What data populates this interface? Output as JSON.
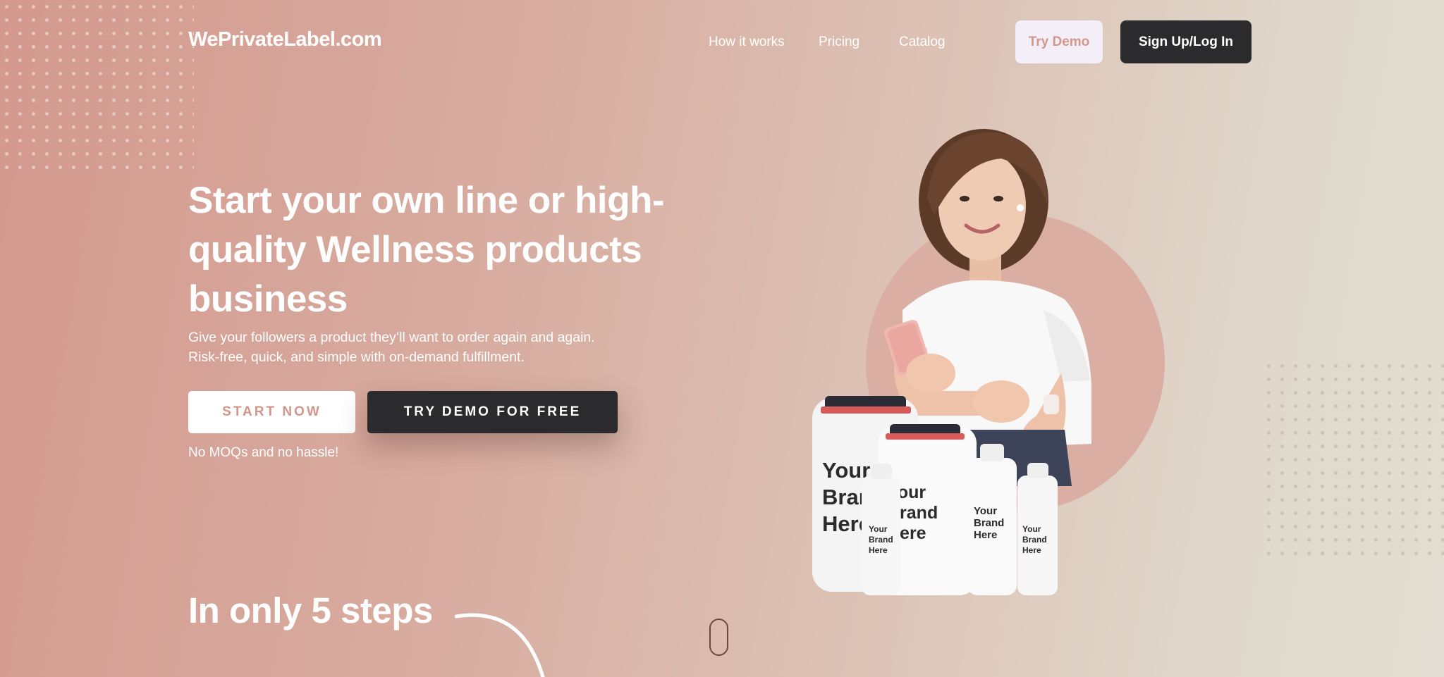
{
  "header": {
    "logo": "WePrivateLabel.com",
    "nav": {
      "how_it_works": "How it works",
      "pricing": "Pricing",
      "catalog": "Catalog"
    },
    "try_demo": "Try Demo",
    "signup": "Sign Up/Log In"
  },
  "hero": {
    "headline_line1": "Start your own line or high-",
    "headline_line2": "quality Wellness products",
    "headline_line3": "business",
    "subtext_line1": "Give your followers a product they’ll want to order again and again.",
    "subtext_line2": "Risk-free, quick, and simple with on-demand fulfillment.",
    "start_now": "START NOW",
    "try_demo_free": "TRY DEMO FOR FREE",
    "note": "No MOQs and no hassle!",
    "bottle_text_large": [
      "Your",
      "Brand",
      "Here"
    ],
    "bottle_text_small": [
      "Your",
      "Brand",
      "Here"
    ]
  },
  "steps": {
    "title": "In only 5 steps"
  },
  "colors": {
    "accent": "#d3968b",
    "dark_button": "#2b2b2d",
    "light_button": "#f4eef8",
    "circle": "#dbaea4"
  }
}
